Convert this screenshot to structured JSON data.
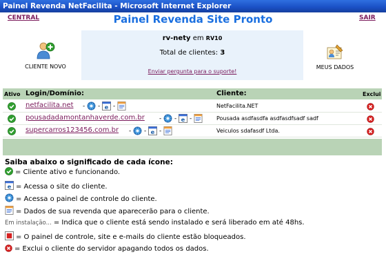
{
  "window": {
    "title": "Painel Revenda NetFacilita - Microsoft Internet Explorer"
  },
  "nav": {
    "central": "CENTRAL",
    "sair": "SAIR"
  },
  "page": {
    "title": "Painel Revenda Site Pronto"
  },
  "info": {
    "user": "rv-nety",
    "em": "em",
    "plan": "RV10",
    "total_label": "Total de clientes:",
    "total_value": "3",
    "support_link": "Enviar pergunta para o suporte!"
  },
  "actions": {
    "novo": "CLIENTE NOVO",
    "dados": "MEUS DADOS"
  },
  "table": {
    "headers": {
      "ativo": "Ativo",
      "login": "Login/Domínio:",
      "cliente": "Cliente:",
      "exclui": "Exclui"
    },
    "separator": "-",
    "rows": [
      {
        "domain": "netfacilita.net",
        "client": "NetFacilita.NET"
      },
      {
        "domain": "pousadadamontanhaverde.com.br",
        "client": "Pousada asdfasdfa asdfasdfsadf sadf"
      },
      {
        "domain": "supercarros123456.com.br",
        "client": "Veiculos sdafasdf Ltda."
      }
    ]
  },
  "legend": {
    "title": "Saiba abaixo o significado de cada ícone:",
    "items": [
      {
        "text": "= Cliente ativo e funcionando."
      },
      {
        "text": "= Acessa o site do cliente."
      },
      {
        "text": "= Acessa o painel de controle do cliente."
      },
      {
        "text": "= Dados de sua revenda que aparecerão para o cliente."
      },
      {
        "prefix": "Em instalação...",
        "text": " = Indica que o cliente está sendo instalado e será liberado em até 48hs."
      },
      {
        "text": "= O painel de controle, site e e-mails do cliente estão bloqueados."
      },
      {
        "text": "= Exclui o cliente do servidor apagando todos os dados."
      }
    ]
  },
  "colors": {
    "title_blue": "#1a6fe0",
    "link_purple": "#7a1a5b",
    "header_green": "#b9d3b6",
    "info_bg": "#e9f2fb"
  }
}
